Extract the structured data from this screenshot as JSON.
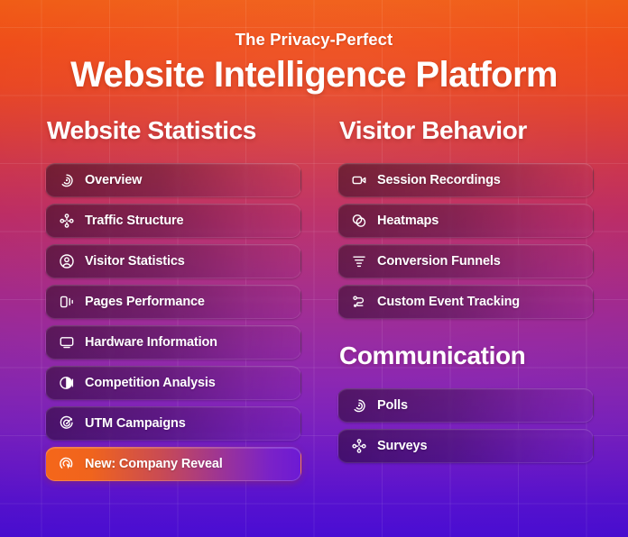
{
  "header": {
    "eyebrow": "The Privacy-Perfect",
    "headline": "Website Intelligence Platform"
  },
  "colors": {
    "gradient_top": "#f05a12",
    "gradient_mid": "#a22a8e",
    "gradient_bottom": "#4f0ee3",
    "highlight_accent": "#f5661a",
    "text": "#ffffff"
  },
  "columns": {
    "left": {
      "sections": [
        {
          "title": "Website Statistics",
          "items": [
            {
              "label": "Overview",
              "icon": "spiral-icon",
              "highlighted": false
            },
            {
              "label": "Traffic Structure",
              "icon": "nodes-icon",
              "highlighted": false
            },
            {
              "label": "Visitor Statistics",
              "icon": "user-circle-icon",
              "highlighted": false
            },
            {
              "label": "Pages Performance",
              "icon": "pages-bars-icon",
              "highlighted": false
            },
            {
              "label": "Hardware Information",
              "icon": "monitor-icon",
              "highlighted": false
            },
            {
              "label": "Competition Analysis",
              "icon": "half-circle-icon",
              "highlighted": false
            },
            {
              "label": "UTM Campaigns",
              "icon": "target-icon",
              "highlighted": false
            },
            {
              "label": "New: Company Reveal",
              "icon": "radar-cursor-icon",
              "highlighted": true
            }
          ]
        }
      ]
    },
    "right": {
      "sections": [
        {
          "title": "Visitor Behavior",
          "items": [
            {
              "label": "Session Recordings",
              "icon": "video-camera-icon",
              "highlighted": false
            },
            {
              "label": "Heatmaps",
              "icon": "heatmap-overlap-icon",
              "highlighted": false
            },
            {
              "label": "Conversion Funnels",
              "icon": "funnel-icon",
              "highlighted": false
            },
            {
              "label": "Custom Event Tracking",
              "icon": "event-path-icon",
              "highlighted": false
            }
          ]
        },
        {
          "title": "Communication",
          "items": [
            {
              "label": "Polls",
              "icon": "spiral-icon",
              "highlighted": false
            },
            {
              "label": "Surveys",
              "icon": "nodes-icon",
              "highlighted": false
            }
          ]
        }
      ]
    }
  }
}
